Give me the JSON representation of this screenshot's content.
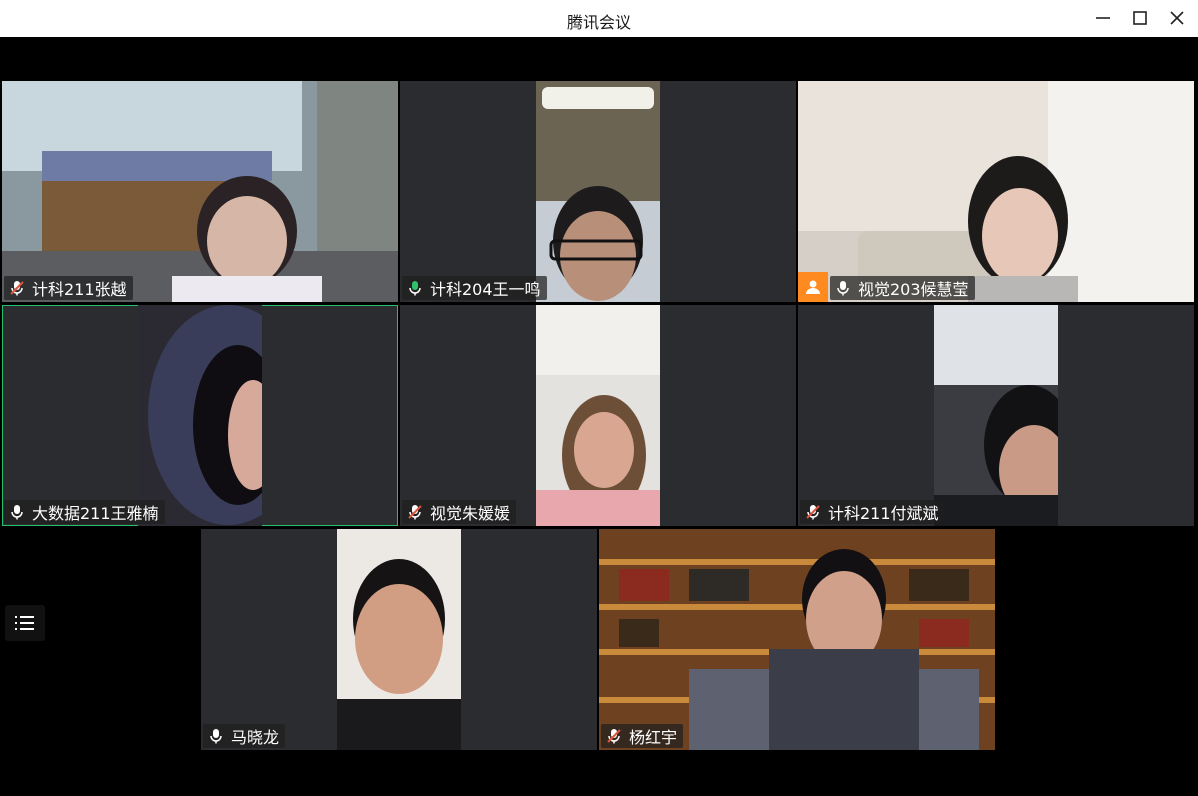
{
  "app": {
    "title": "腾讯会议"
  },
  "window_controls": {
    "minimize": "minimize-icon",
    "maximize": "maximize-icon",
    "close": "close-icon"
  },
  "participants": [
    {
      "name": "计科211张越",
      "mic": "muted"
    },
    {
      "name": "计科204王一鸣",
      "mic": "speaking"
    },
    {
      "name": "视觉203候慧莹",
      "mic": "on",
      "host": true
    },
    {
      "name": "大数据211王雅楠",
      "mic": "on",
      "active": true
    },
    {
      "name": "视觉朱媛媛",
      "mic": "muted"
    },
    {
      "name": "计科211付斌斌",
      "mic": "muted"
    },
    {
      "name": "马晓龙",
      "mic": "on"
    },
    {
      "name": "杨红宇",
      "mic": "muted"
    }
  ],
  "toolbar": {
    "member_list_icon": "list-icon"
  },
  "colors": {
    "tile_bg": "#2b2c2f",
    "active_border": "#23c16b",
    "host_badge": "#ff8a1f",
    "mic_muted": "#e0533d",
    "mic_speaking": "#2ec26a"
  }
}
